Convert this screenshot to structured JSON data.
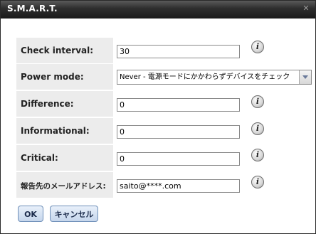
{
  "dialog": {
    "title": "S.M.A.R.T.",
    "close_symbol": "✕"
  },
  "fields": [
    {
      "label": "Check interval:",
      "value": "30",
      "type": "text",
      "info": true
    },
    {
      "label": "Power mode:",
      "value": "Never - 電源モードにかかわらずデバイスをチェック",
      "type": "select",
      "info": false
    },
    {
      "label": "Difference:",
      "value": "0",
      "type": "text",
      "info": true
    },
    {
      "label": "Informational:",
      "value": "0",
      "type": "text",
      "info": true
    },
    {
      "label": "Critical:",
      "value": "0",
      "type": "text",
      "info": true
    },
    {
      "label": "報告先のメールアドレス:",
      "value": "saito@****.com",
      "type": "text",
      "info": true
    }
  ],
  "info_icon_glyph": "i",
  "icons": {
    "info": "info-icon",
    "close": "close-icon",
    "dropdown": "chevron-down-icon"
  },
  "buttons": {
    "ok_label": "OK",
    "cancel_label": "キャンセル"
  }
}
